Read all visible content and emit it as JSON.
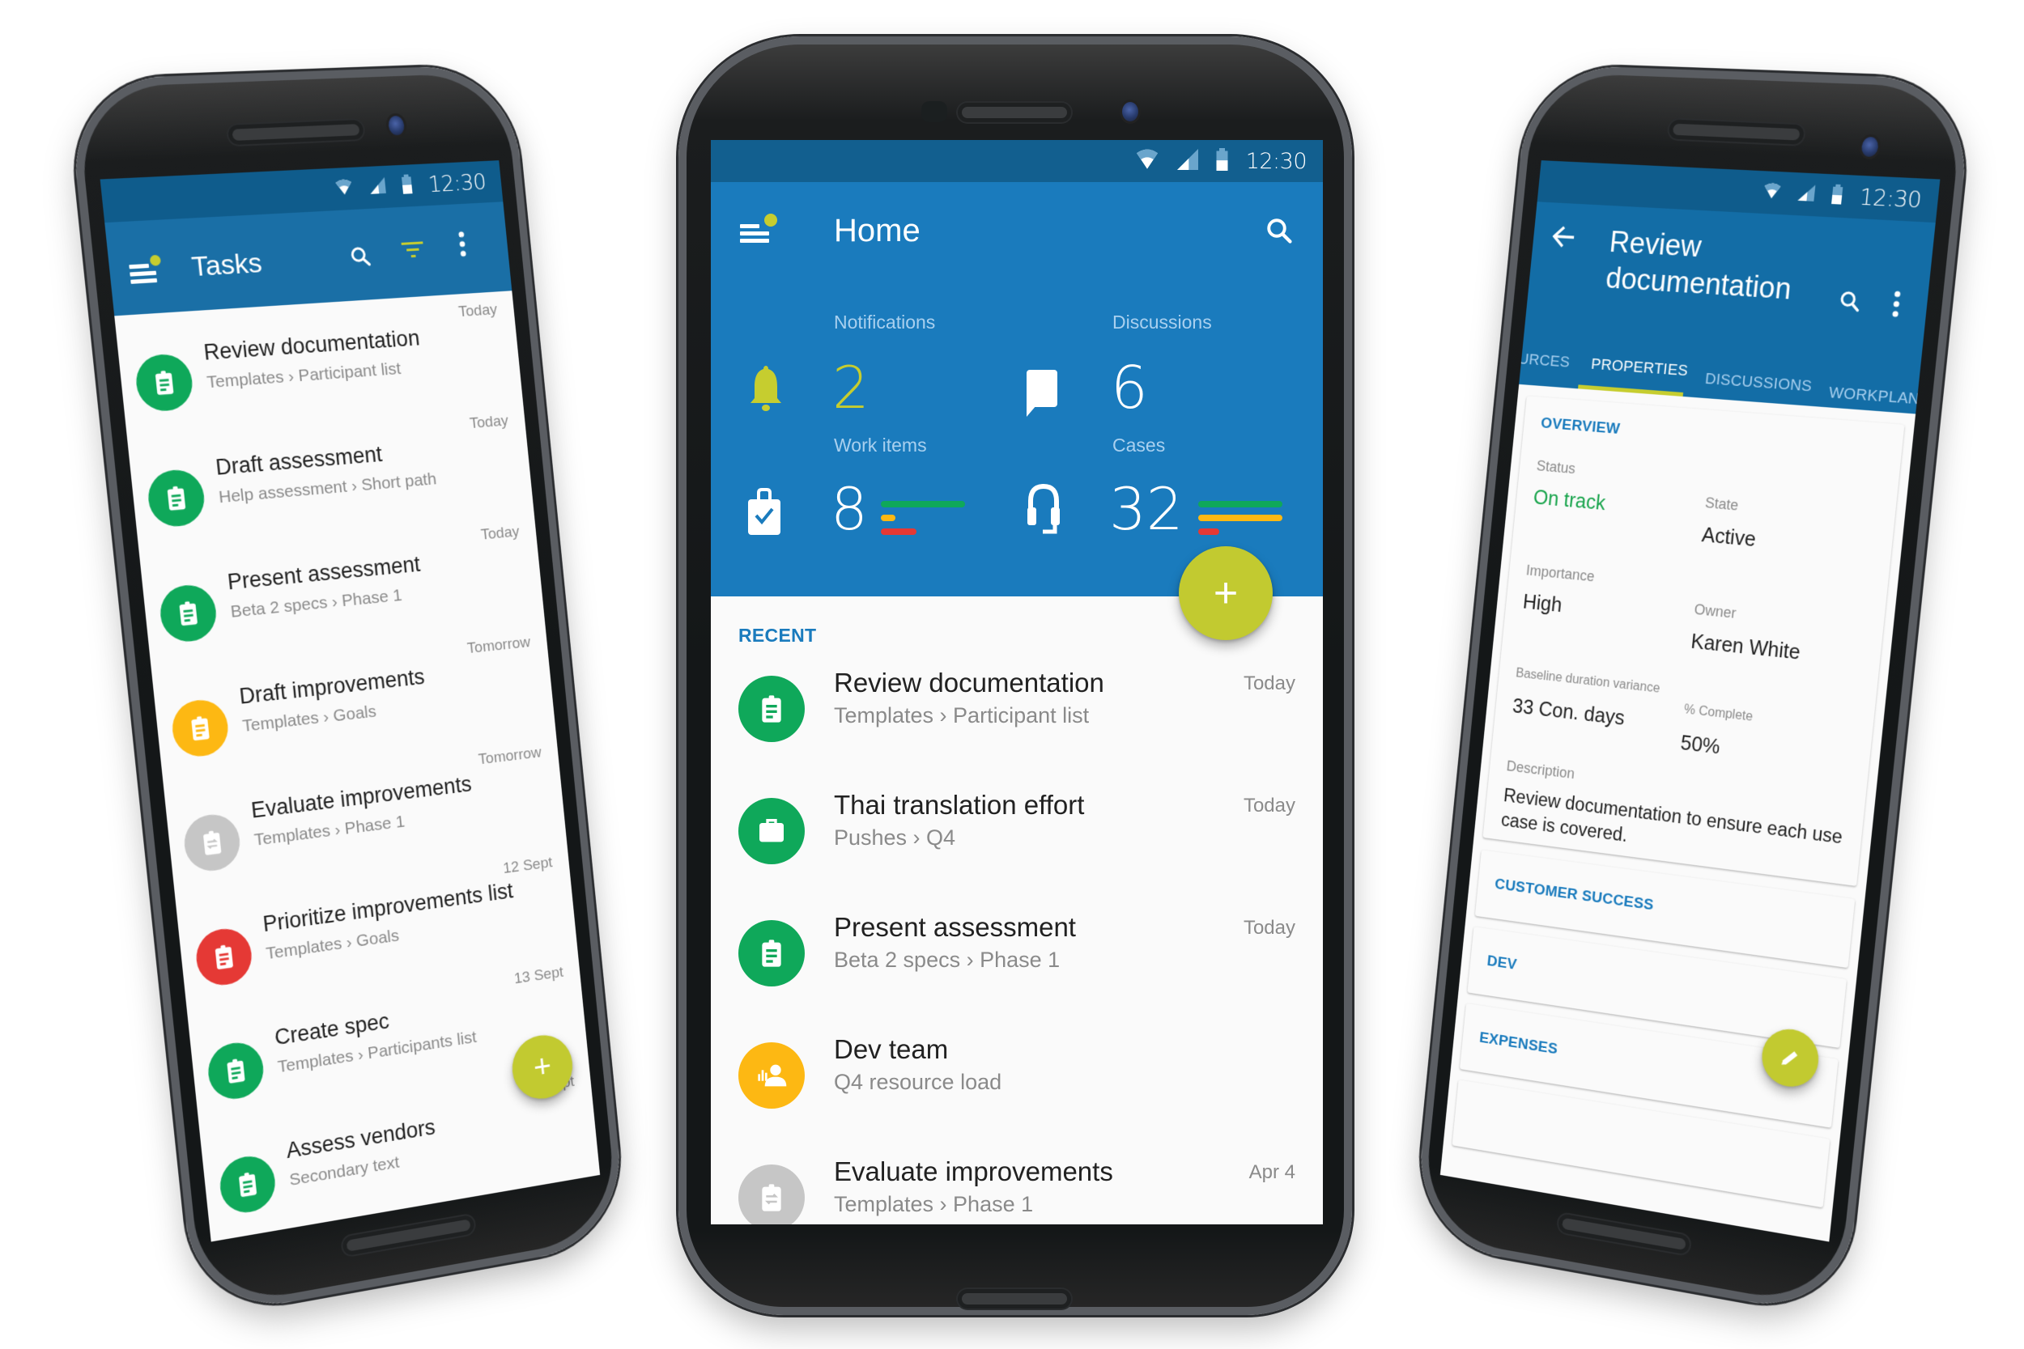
{
  "status_bar": {
    "time": "12:30"
  },
  "colors": {
    "primary": "#1a7bbd",
    "primary_dark": "#125f8f",
    "accent": "#c2ca30",
    "green": "#0fa85a",
    "amber": "#fdb813",
    "red": "#e53935",
    "grey": "#c6c6c6",
    "on_track": "#16a34a"
  },
  "tasks_screen": {
    "title": "Tasks",
    "actions": [
      "search",
      "filter",
      "more"
    ],
    "items": [
      {
        "title": "Review documentation",
        "subtitle": "Templates › Participant list",
        "date": "Today",
        "color": "green",
        "icon": "clipboard"
      },
      {
        "title": "Draft assessment",
        "subtitle": "Help assessment › Short path",
        "date": "Today",
        "color": "green",
        "icon": "clipboard"
      },
      {
        "title": "Present assessment",
        "subtitle": "Beta 2 specs › Phase 1",
        "date": "Today",
        "color": "green",
        "icon": "clipboard"
      },
      {
        "title": "Draft improvements",
        "subtitle": "Templates › Goals",
        "date": "Tomorrow",
        "color": "amber",
        "icon": "clipboard"
      },
      {
        "title": "Evaluate improvements",
        "subtitle": "Templates › Phase 1",
        "date": "Tomorrow",
        "color": "grey",
        "icon": "clipboard-repeat"
      },
      {
        "title": "Prioritize improvements list",
        "subtitle": "Templates › Goals",
        "date": "12 Sept",
        "color": "red",
        "icon": "clipboard"
      },
      {
        "title": "Create spec",
        "subtitle": "Templates › Participants list",
        "date": "13 Sept",
        "color": "green",
        "icon": "clipboard"
      },
      {
        "title": "Assess vendors",
        "subtitle": "Secondary text",
        "date": "20 Sept",
        "color": "green",
        "icon": "clipboard"
      }
    ],
    "fab_label": "+"
  },
  "home_screen": {
    "title": "Home",
    "stats": [
      {
        "label": "Notifications",
        "value": "2",
        "icon": "bell"
      },
      {
        "label": "Discussions",
        "value": "6",
        "icon": "chat-bubble"
      },
      {
        "label": "Work items",
        "value": "8",
        "icon": "briefcase-check",
        "bars": [
          {
            "color": "green",
            "fraction": 1.0
          },
          {
            "color": "amber",
            "fraction": 0.17
          },
          {
            "color": "red",
            "fraction": 0.42
          }
        ]
      },
      {
        "label": "Cases",
        "value": "32",
        "icon": "headset",
        "bars": [
          {
            "color": "green",
            "fraction": 1.0
          },
          {
            "color": "amber",
            "fraction": 1.0
          },
          {
            "color": "red",
            "fraction": 0.25
          }
        ]
      }
    ],
    "fab_label": "+",
    "recent_header": "RECENT",
    "recent": [
      {
        "title": "Review documentation",
        "subtitle": "Templates › Participant list",
        "date": "Today",
        "color": "green",
        "icon": "clipboard"
      },
      {
        "title": "Thai translation effort",
        "subtitle": "Pushes › Q4",
        "date": "Today",
        "color": "green",
        "icon": "briefcase"
      },
      {
        "title": "Present assessment",
        "subtitle": "Beta 2 specs › Phase 1",
        "date": "Today",
        "color": "green",
        "icon": "clipboard"
      },
      {
        "title": "Dev team",
        "subtitle": "Q4 resource load",
        "date": "",
        "color": "amber",
        "icon": "person-chart"
      },
      {
        "title": "Evaluate improvements",
        "subtitle": "Templates › Phase 1",
        "date": "Apr 4",
        "color": "grey",
        "icon": "clipboard-repeat"
      }
    ]
  },
  "detail_screen": {
    "title": "Review documentation",
    "tabs": [
      {
        "label": "URCES",
        "active": false
      },
      {
        "label": "PROPERTIES",
        "active": true
      },
      {
        "label": "DISCUSSIONS",
        "active": false
      },
      {
        "label": "WORKPLAN",
        "active": false
      }
    ],
    "overview": {
      "header": "OVERVIEW",
      "fields": [
        {
          "label": "Status",
          "value": "On track"
        },
        {
          "label": "State",
          "value": "Active"
        },
        {
          "label": "Importance",
          "value": "High"
        },
        {
          "label": "Owner",
          "value": "Karen White"
        },
        {
          "label": "Baseline duration variance",
          "value": "33 Con. days"
        },
        {
          "label": "% Complete",
          "value": "50%"
        }
      ],
      "description_label": "Description",
      "description": "Review documentation to ensure each use case is covered."
    },
    "sections": [
      "CUSTOMER SUCCESS",
      "DEV",
      "EXPENSES"
    ],
    "fab_icon": "pencil"
  }
}
